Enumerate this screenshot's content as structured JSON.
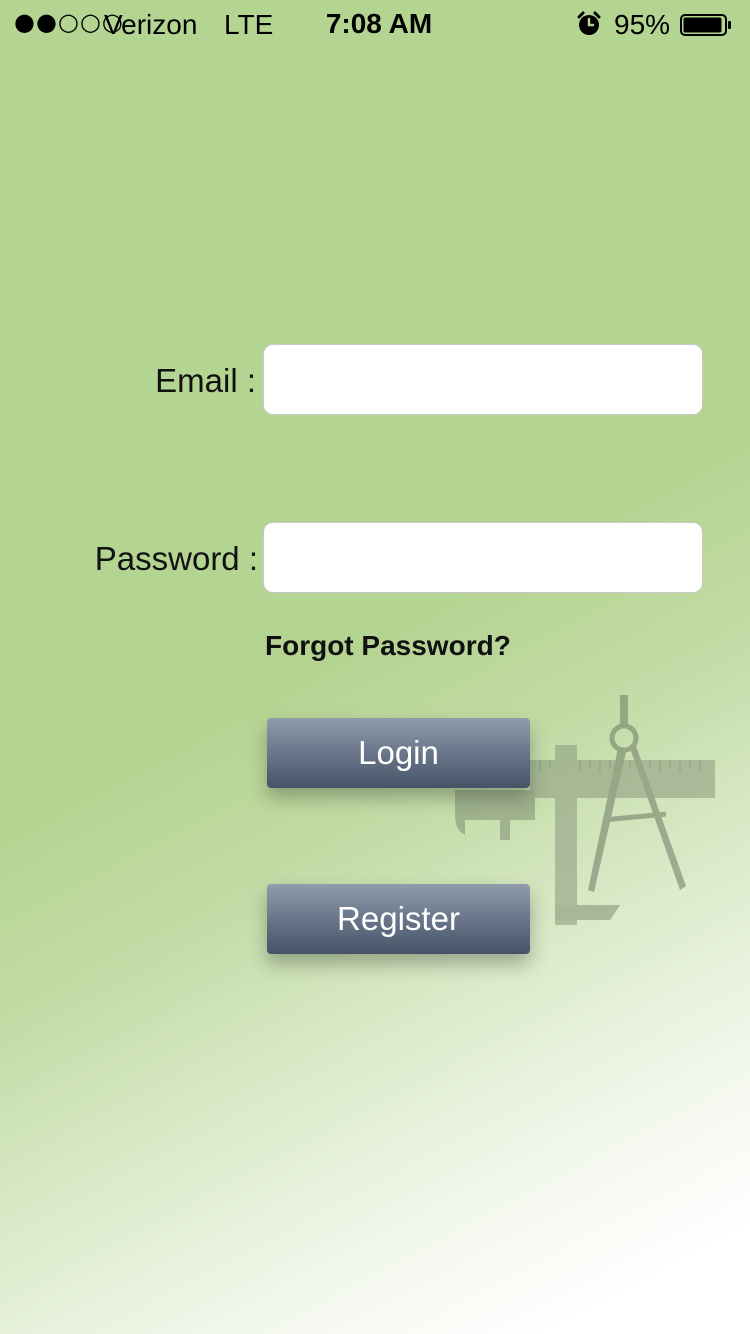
{
  "status_bar": {
    "signal": "●●○○○",
    "carrier": "Verizon",
    "network": "LTE",
    "time": "7:08 AM",
    "battery_percent": "95%",
    "alarm_icon": "alarm-clock-icon",
    "battery_icon": "battery-icon",
    "battery_level": 0.95
  },
  "form": {
    "email_label": "Email :",
    "email_value": "",
    "password_label": "Password :",
    "password_value": "",
    "forgot_password": "Forgot Password?"
  },
  "buttons": {
    "login": "Login",
    "register": "Register"
  },
  "decoration": {
    "icon": "drafting-tools-icon"
  },
  "colors": {
    "background": "#b4d491",
    "button_top": "#919cab",
    "button_bottom": "#465468"
  }
}
